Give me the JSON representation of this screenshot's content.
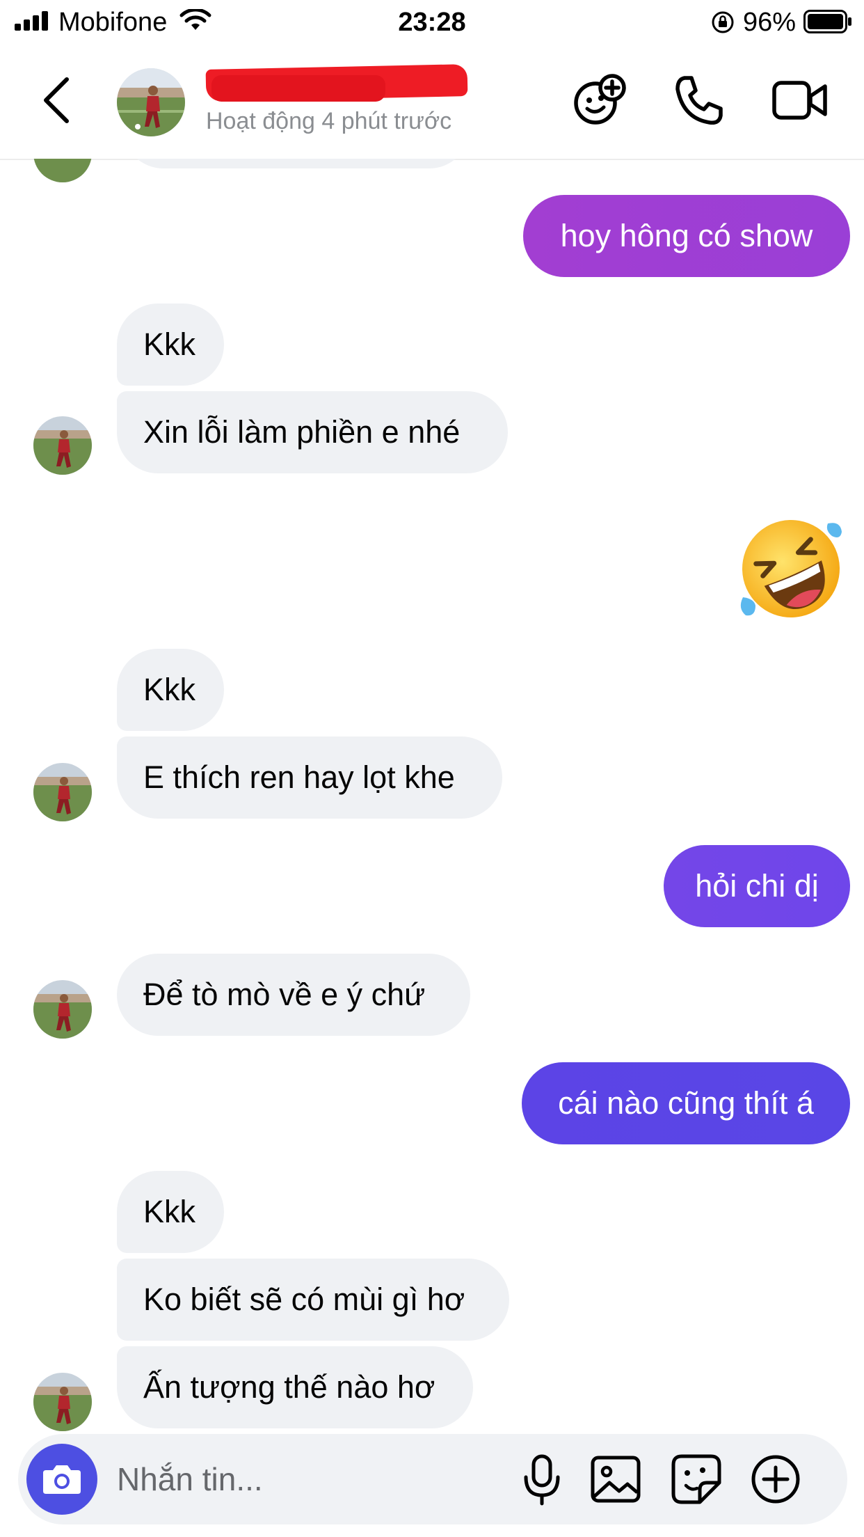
{
  "status_bar": {
    "carrier": "Mobifone",
    "time": "23:28",
    "battery": "96%"
  },
  "header": {
    "contact_name": "",
    "activity": "Hoạt động 4 phút trước",
    "icons": [
      "back-icon",
      "avatar",
      "games-icon",
      "phone-icon",
      "video-icon"
    ]
  },
  "theme": {
    "outgoing_gradient": [
      "#a33bd0",
      "#7a46e8",
      "#5b45e6"
    ],
    "incoming_bg": "#eff1f4",
    "accent": "#4d4fe2"
  },
  "messages": [
    {
      "from": "me",
      "text": "hoy hông có show"
    },
    {
      "from": "them",
      "text": "Kkk"
    },
    {
      "from": "them",
      "text": "Xin lỗi làm phiền e nhé"
    },
    {
      "from": "me",
      "emoji": "rolling-on-floor-laughing"
    },
    {
      "from": "them",
      "text": "Kkk"
    },
    {
      "from": "them",
      "text": "E thích ren hay lọt khe"
    },
    {
      "from": "me",
      "text": "hỏi chi dị"
    },
    {
      "from": "them",
      "text": "Để tò mò về e ý chứ"
    },
    {
      "from": "me",
      "text": "cái nào cũng thít á"
    },
    {
      "from": "them",
      "text": "Kkk"
    },
    {
      "from": "them",
      "text": "Ko biết sẽ có mùi gì hơ"
    },
    {
      "from": "them",
      "text": "Ấn tượng thế nào hơ"
    }
  ],
  "composer": {
    "placeholder": "Nhắn tin...",
    "icons": [
      "camera-icon",
      "microphone-icon",
      "gallery-icon",
      "sticker-icon",
      "add-icon"
    ]
  }
}
